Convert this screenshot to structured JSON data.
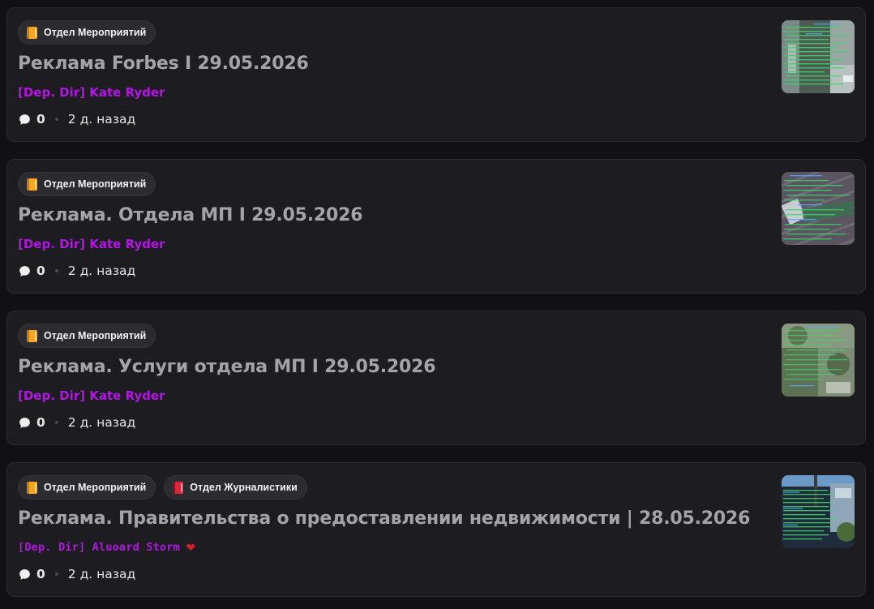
{
  "posts": [
    {
      "tags": [
        {
          "label": "Отдел Мероприятий",
          "icon": "orange-book-icon",
          "color": "#f5a623"
        }
      ],
      "title": "Реклама Forbes I 29.05.2026",
      "author": "[Dep. Dir] Kate Ryder",
      "author_color": "#b117e0",
      "comments": "0",
      "time": "2 д. назад",
      "thumbnail_label": "screenshot-thumbnail"
    },
    {
      "tags": [
        {
          "label": "Отдел Мероприятий",
          "icon": "orange-book-icon",
          "color": "#f5a623"
        }
      ],
      "title": "Реклама. Отдела МП I 29.05.2026",
      "author": "[Dep. Dir] Kate Ryder",
      "author_color": "#b117e0",
      "comments": "0",
      "time": "2 д. назад",
      "thumbnail_label": "screenshot-thumbnail"
    },
    {
      "tags": [
        {
          "label": "Отдел Мероприятий",
          "icon": "orange-book-icon",
          "color": "#f5a623"
        }
      ],
      "title": "Реклама. Услуги отдела МП I 29.05.2026",
      "author": "[Dep. Dir] Kate Ryder",
      "author_color": "#b117e0",
      "comments": "0",
      "time": "2 д. назад",
      "thumbnail_label": "screenshot-thumbnail"
    },
    {
      "tags": [
        {
          "label": "Отдел Мероприятий",
          "icon": "orange-book-icon",
          "color": "#f5a623"
        },
        {
          "label": "Отдел Журналистики",
          "icon": "red-book-icon",
          "color": "#d7263d"
        }
      ],
      "title": "Реклама. Правительства о предоставлении недвижимости | 28.05.2026",
      "author": "[Dep. Dir] Aluoard Storm",
      "author_color": "#b117e0",
      "author_badge": "heart-icon",
      "comments": "0",
      "time": "2 д. назад",
      "thumbnail_label": "screenshot-thumbnail"
    }
  ]
}
